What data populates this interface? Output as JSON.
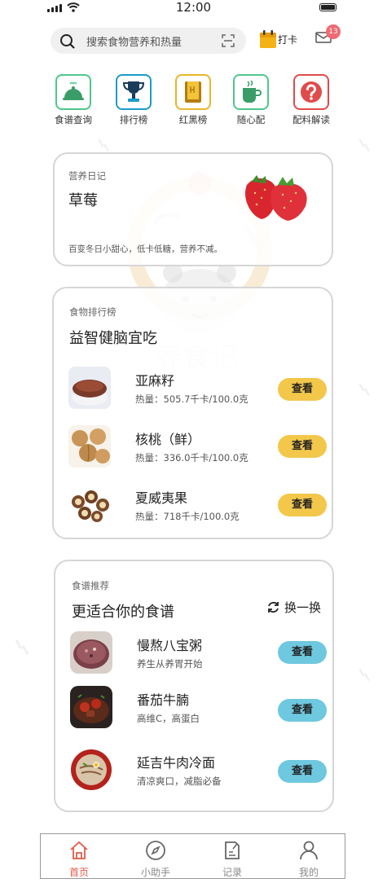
{
  "status_bar": {
    "time": "12:00"
  },
  "search": {
    "placeholder": "搜索食物营养和热量"
  },
  "checkin": {
    "label": "打卡"
  },
  "mail": {
    "badge_count": "13"
  },
  "quick_actions": [
    {
      "label": "食谱查询",
      "icon": "cloche-icon",
      "color": "#4fc78a"
    },
    {
      "label": "排行榜",
      "icon": "trophy-icon",
      "color": "#1a9cc9"
    },
    {
      "label": "红黑榜",
      "icon": "book-icon",
      "color": "#e8b72a"
    },
    {
      "label": "随心配",
      "icon": "cup-icon",
      "color": "#4fc78a"
    },
    {
      "label": "配料解读",
      "icon": "question-icon",
      "color": "#e04b4b"
    }
  ],
  "diary": {
    "label": "营养日记",
    "title": "草莓",
    "description": "百变冬日小甜心，低卡低糖，营养不减。"
  },
  "ranking": {
    "label": "食物排行榜",
    "title": "益智健脑宜吃",
    "button_label": "查看",
    "items": [
      {
        "name": "亚麻籽",
        "calories": "热量：505.7千卡/100.0克"
      },
      {
        "name": "核桃（鲜）",
        "calories": "热量：336.0千卡/100.0克"
      },
      {
        "name": "夏威夷果",
        "calories": "热量：718千卡/100.0克"
      }
    ]
  },
  "recipes": {
    "label": "食谱推荐",
    "title": "更适合你的食谱",
    "swap_label": "换一换",
    "button_label": "查看",
    "items": [
      {
        "name": "慢熬八宝粥",
        "subtitle": "养生从养胃开始"
      },
      {
        "name": "番茄牛腩",
        "subtitle": "高维C，高蛋白"
      },
      {
        "name": "延吉牛肉冷面",
        "subtitle": "清凉爽口，减脂必备"
      }
    ]
  },
  "tabbar": {
    "tabs": [
      {
        "label": "首页",
        "icon": "home-icon",
        "active": true
      },
      {
        "label": "小助手",
        "icon": "compass-icon",
        "active": false
      },
      {
        "label": "记录",
        "icon": "note-icon",
        "active": false
      },
      {
        "label": "我的",
        "icon": "user-icon",
        "active": false
      }
    ]
  },
  "colors": {
    "accent_red": "#e25b4a",
    "button_yellow": "#f2c74a",
    "button_blue": "#6ec8df",
    "badge": "#ef6a72"
  },
  "watermark": {
    "logo_text": "养食记"
  }
}
